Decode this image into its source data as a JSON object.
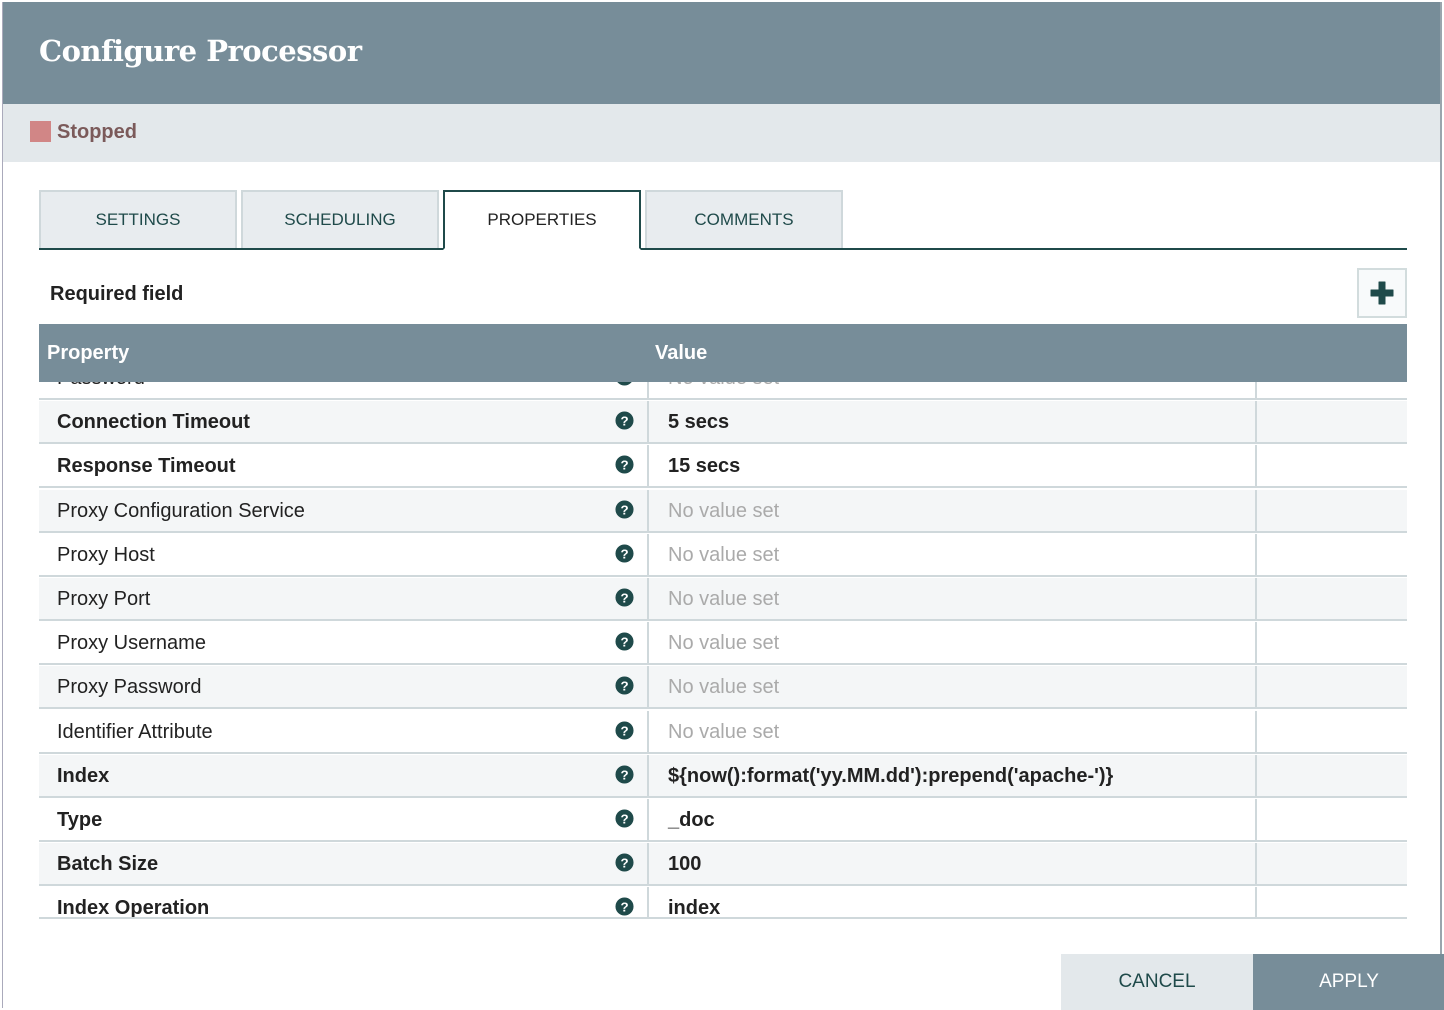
{
  "dialog": {
    "title": "Configure Processor",
    "status": "Stopped",
    "status_color": "#d18686"
  },
  "tabs": [
    {
      "label": "SETTINGS",
      "active": false
    },
    {
      "label": "SCHEDULING",
      "active": false
    },
    {
      "label": "PROPERTIES",
      "active": true
    },
    {
      "label": "COMMENTS",
      "active": false
    }
  ],
  "required_label": "Required field",
  "add_icon": "plus-icon",
  "table": {
    "headers": [
      "Property",
      "Value"
    ],
    "rows": [
      {
        "name": "Password",
        "value": "No value set",
        "required": false,
        "set": false
      },
      {
        "name": "Connection Timeout",
        "value": "5 secs",
        "required": true,
        "set": true
      },
      {
        "name": "Response Timeout",
        "value": "15 secs",
        "required": true,
        "set": true
      },
      {
        "name": "Proxy Configuration Service",
        "value": "No value set",
        "required": false,
        "set": false
      },
      {
        "name": "Proxy Host",
        "value": "No value set",
        "required": false,
        "set": false
      },
      {
        "name": "Proxy Port",
        "value": "No value set",
        "required": false,
        "set": false
      },
      {
        "name": "Proxy Username",
        "value": "No value set",
        "required": false,
        "set": false
      },
      {
        "name": "Proxy Password",
        "value": "No value set",
        "required": false,
        "set": false
      },
      {
        "name": "Identifier Attribute",
        "value": "No value set",
        "required": false,
        "set": false
      },
      {
        "name": "Index",
        "value": "${now():format('yy.MM.dd'):prepend('apache-')}",
        "required": true,
        "set": true
      },
      {
        "name": "Type",
        "value": "_doc",
        "required": true,
        "set": true
      },
      {
        "name": "Batch Size",
        "value": "100",
        "required": true,
        "set": true
      },
      {
        "name": "Index Operation",
        "value": "index",
        "required": true,
        "set": true
      }
    ]
  },
  "buttons": {
    "cancel": "CANCEL",
    "apply": "APPLY"
  }
}
